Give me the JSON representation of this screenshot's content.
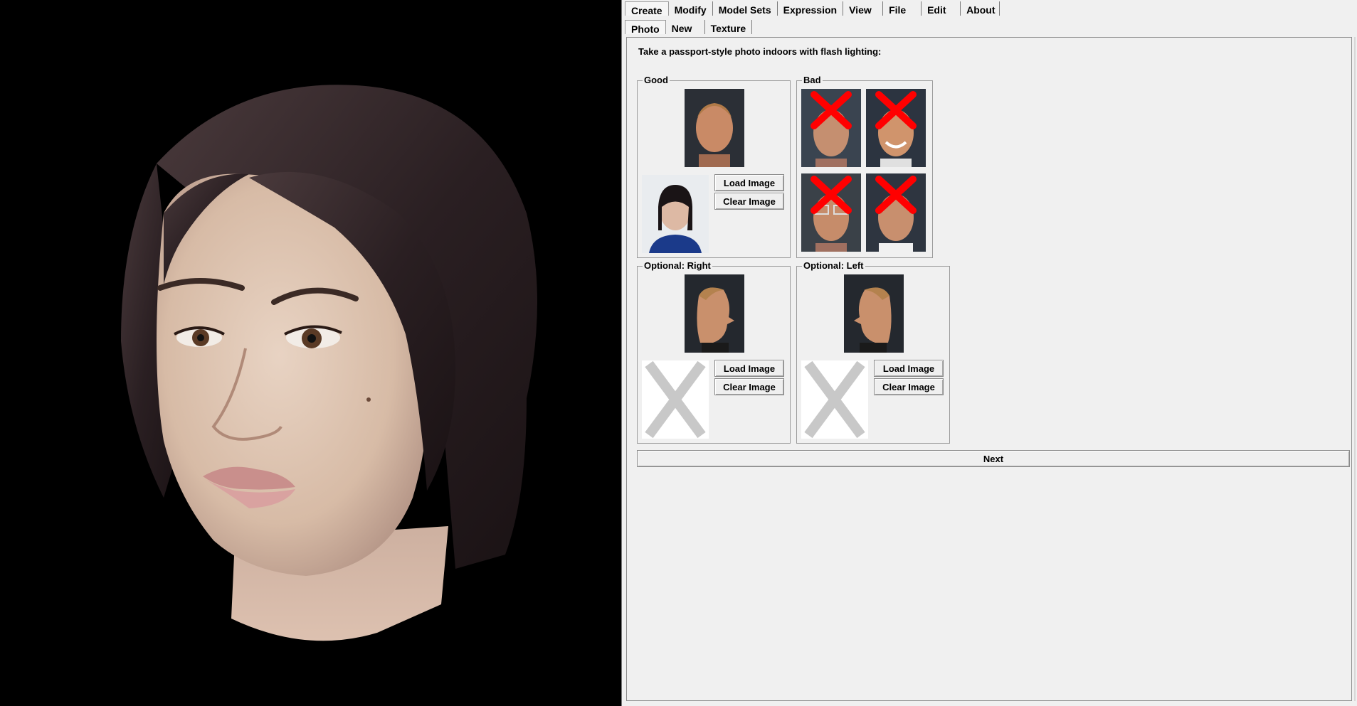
{
  "menu": {
    "tabs": [
      {
        "label": "Create",
        "active": true
      },
      {
        "label": "Modify"
      },
      {
        "label": "Model Sets"
      },
      {
        "label": "Expression"
      },
      {
        "label": "View"
      },
      {
        "label": "File"
      },
      {
        "label": "Edit"
      },
      {
        "label": "About"
      }
    ]
  },
  "subtabs": [
    {
      "label": "Photo",
      "active": true
    },
    {
      "label": "New"
    },
    {
      "label": "Texture"
    }
  ],
  "instruction": "Take a passport-style photo indoors with flash lighting:",
  "groups": {
    "good": {
      "title": "Good",
      "load_label": "Load Image",
      "clear_label": "Clear Image"
    },
    "bad": {
      "title": "Bad"
    },
    "right": {
      "title": "Optional: Right",
      "load_label": "Load Image",
      "clear_label": "Clear Image"
    },
    "left": {
      "title": "Optional: Left",
      "load_label": "Load Image",
      "clear_label": "Clear Image"
    }
  },
  "next_label": "Next",
  "colors": {
    "panel_bg": "#f0f0f0",
    "viewport_bg": "#000000",
    "bad_mark": "#ff0000",
    "placeholder_x": "#c8c8c8"
  }
}
